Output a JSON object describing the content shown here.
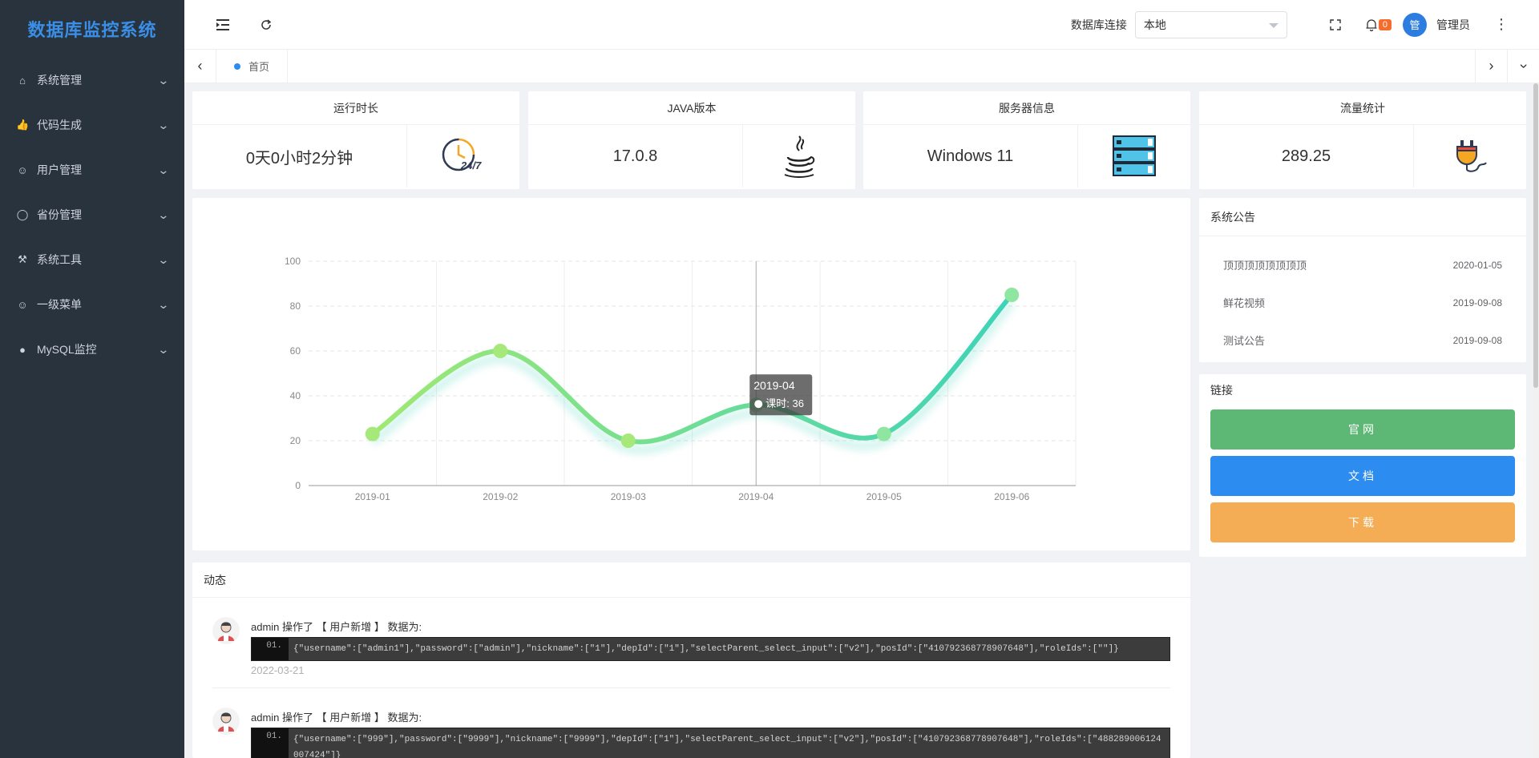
{
  "app": {
    "title": "数据库监控系统"
  },
  "sidebar": {
    "items": [
      {
        "label": "系统管理",
        "icon": "home-icon"
      },
      {
        "label": "代码生成",
        "icon": "thumb-up-icon"
      },
      {
        "label": "用户管理",
        "icon": "user-icon"
      },
      {
        "label": "省份管理",
        "icon": "globe-icon"
      },
      {
        "label": "系统工具",
        "icon": "tools-icon"
      },
      {
        "label": "一级菜单",
        "icon": "smile-icon"
      },
      {
        "label": "MySQL监控",
        "icon": "circle-icon"
      }
    ]
  },
  "header": {
    "db_label": "数据库连接",
    "db_selected": "本地",
    "notification_count": "0",
    "avatar_text": "管",
    "username": "管理员"
  },
  "tabs": {
    "home_label": "首页"
  },
  "stats": [
    {
      "title": "运行时长",
      "value": "0天0小时2分钟",
      "icon": "clock-24-7-icon"
    },
    {
      "title": "JAVA版本",
      "value": "17.0.8",
      "icon": "java-icon"
    },
    {
      "title": "服务器信息",
      "value": "Windows 11",
      "icon": "server-icon"
    },
    {
      "title": "流量统计",
      "value": "289.25",
      "icon": "plug-icon"
    }
  ],
  "clock_label": "24/7",
  "chart_data": {
    "type": "line",
    "categories": [
      "2019-01",
      "2019-02",
      "2019-03",
      "2019-04",
      "2019-05",
      "2019-06"
    ],
    "series": [
      {
        "name": "课时",
        "values": [
          23,
          60,
          20,
          36,
          23,
          85
        ]
      }
    ],
    "ylim": [
      0,
      100
    ],
    "yticks": [
      0,
      20,
      40,
      60,
      80,
      100
    ],
    "grid": true,
    "tooltip": {
      "title": "2019-04",
      "text": "课时: 36"
    },
    "colors": {
      "start": "#a0e872",
      "end": "#3dd3b8"
    }
  },
  "notice": {
    "title": "系统公告",
    "items": [
      {
        "title": "顶顶顶顶顶顶顶顶",
        "date": "2020-01-05"
      },
      {
        "title": "鲜花视频",
        "date": "2019-09-08"
      },
      {
        "title": "测试公告",
        "date": "2019-09-08"
      }
    ]
  },
  "links": {
    "title": "链接",
    "buttons": [
      {
        "label": "官网",
        "color": "#5cb874"
      },
      {
        "label": "文档",
        "color": "#2d8cf0"
      },
      {
        "label": "下载",
        "color": "#f5ad55"
      }
    ]
  },
  "activity": {
    "title": "动态",
    "items": [
      {
        "head": "admin 操作了 【 用户新增 】 数据为:",
        "line_no": "01.",
        "code": "{\"username\":[\"admin1\"],\"password\":[\"admin\"],\"nickname\":[\"1\"],\"depId\":[\"1\"],\"selectParent_select_input\":[\"v2\"],\"posId\":[\"410792368778907648\"],\"roleIds\":[\"\"]}",
        "date": "2022-03-21"
      },
      {
        "head": "admin 操作了 【 用户新增 】 数据为:",
        "line_no": "01.",
        "code": "{\"username\":[\"999\"],\"password\":[\"9999\"],\"nickname\":[\"9999\"],\"depId\":[\"1\"],\"selectParent_select_input\":[\"v2\"],\"posId\":[\"410792368778907648\"],\"roleIds\":[\"488289006124007424\"]}",
        "date": ""
      }
    ]
  }
}
